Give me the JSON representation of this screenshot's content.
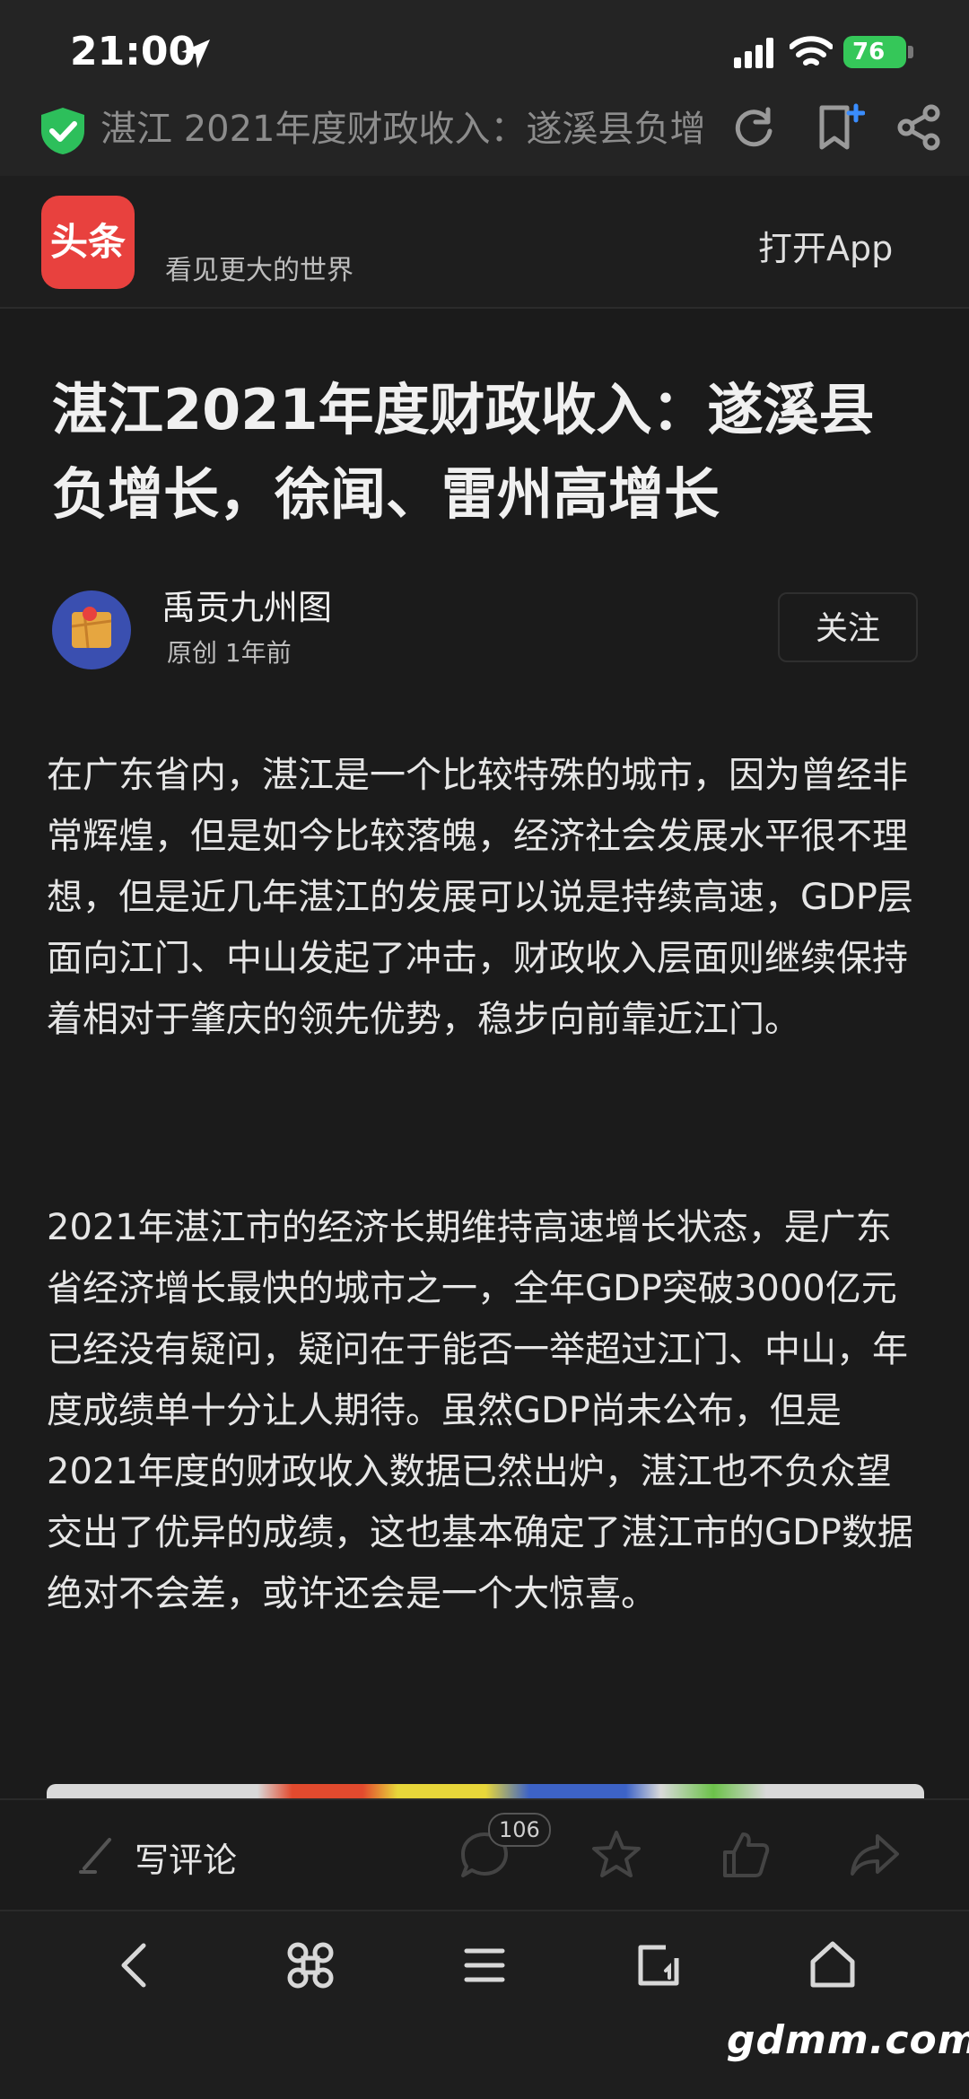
{
  "status_bar": {
    "time": "21:00",
    "battery": "76"
  },
  "url_bar": {
    "title": "湛江 2021年度财政收入：遂溪县负增"
  },
  "banner": {
    "app_logo_text": "头条",
    "slogan": "看见更大的世界",
    "open_app": "打开App"
  },
  "article": {
    "title": "湛江2021年度财政收入：遂溪县负增长，徐闻、雷州高增长",
    "author": {
      "name": "禹贡九州图",
      "meta": "原创  1年前"
    },
    "follow_label": "关注",
    "paragraphs": [
      "在广东省内，湛江是一个比较特殊的城市，因为曾经非常辉煌，但是如今比较落魄，经济社会发展水平很不理想，但是近几年湛江的发展可以说是持续高速，GDP层面向江门、中山发起了冲击，财政收入层面则继续保持着相对于肇庆的领先优势，稳步向前靠近江门。",
      "2021年湛江市的经济长期维持高速增长状态，是广东省经济增长最快的城市之一，全年GDP突破3000亿元已经没有疑问，疑问在于能否一举超过江门、中山，年度成绩单十分让人期待。虽然GDP尚未公布，但是2021年度的财政收入数据已然出炉，湛江也不负众望交出了优异的成绩，这也基本确定了湛江市的GDP数据绝对不会差，或许还会是一个大惊喜。"
    ]
  },
  "comment_bar": {
    "write_comment": "写评论",
    "comment_count": "106"
  },
  "watermark": "gdmm.com",
  "colors": {
    "background": "#1b1b1b",
    "brand_red": "#e8413e",
    "battery_green": "#35c759",
    "shield_green": "#2dbf5b"
  },
  "icons": [
    "location-arrow-icon",
    "signal-icon",
    "wifi-icon",
    "shield-icon",
    "refresh-icon",
    "bookmark-add-icon",
    "share-icon",
    "pen-icon",
    "comment-icon",
    "star-icon",
    "like-icon",
    "forward-icon",
    "back-icon",
    "command-icon",
    "menu-icon",
    "tabs-icon",
    "home-icon"
  ]
}
